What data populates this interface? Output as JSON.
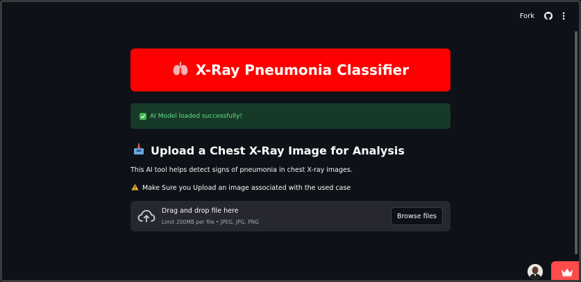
{
  "toolbar": {
    "fork_label": "Fork",
    "github_icon": "github-icon",
    "menu_icon": "kebab-menu-icon"
  },
  "title": {
    "icon": "lungs-icon",
    "text": "X-Ray Pneumonia Classifier",
    "bg_color": "#ff0000"
  },
  "status": {
    "icon": "check-box-icon",
    "text": "AI Model loaded successfully!",
    "color": "#5ce488"
  },
  "upload_section": {
    "icon": "inbox-tray-icon",
    "heading": "Upload a Chest X-Ray Image for Analysis",
    "description": "This AI tool helps detect signs of pneumonia in chest X-ray images.",
    "warning_icon": "warning-icon",
    "warning": "Make Sure you Upload an image associated with the used case"
  },
  "uploader": {
    "icon": "cloud-upload-icon",
    "drag_text": "Drag and drop file here",
    "limit_text": "Limit 200MB per file • JPEG, JPG, PNG",
    "browse_label": "Browse files"
  },
  "footer": {
    "avatar_icon": "user-avatar",
    "badge_icon": "crown-icon",
    "badge_color": "#ff4b4b"
  }
}
